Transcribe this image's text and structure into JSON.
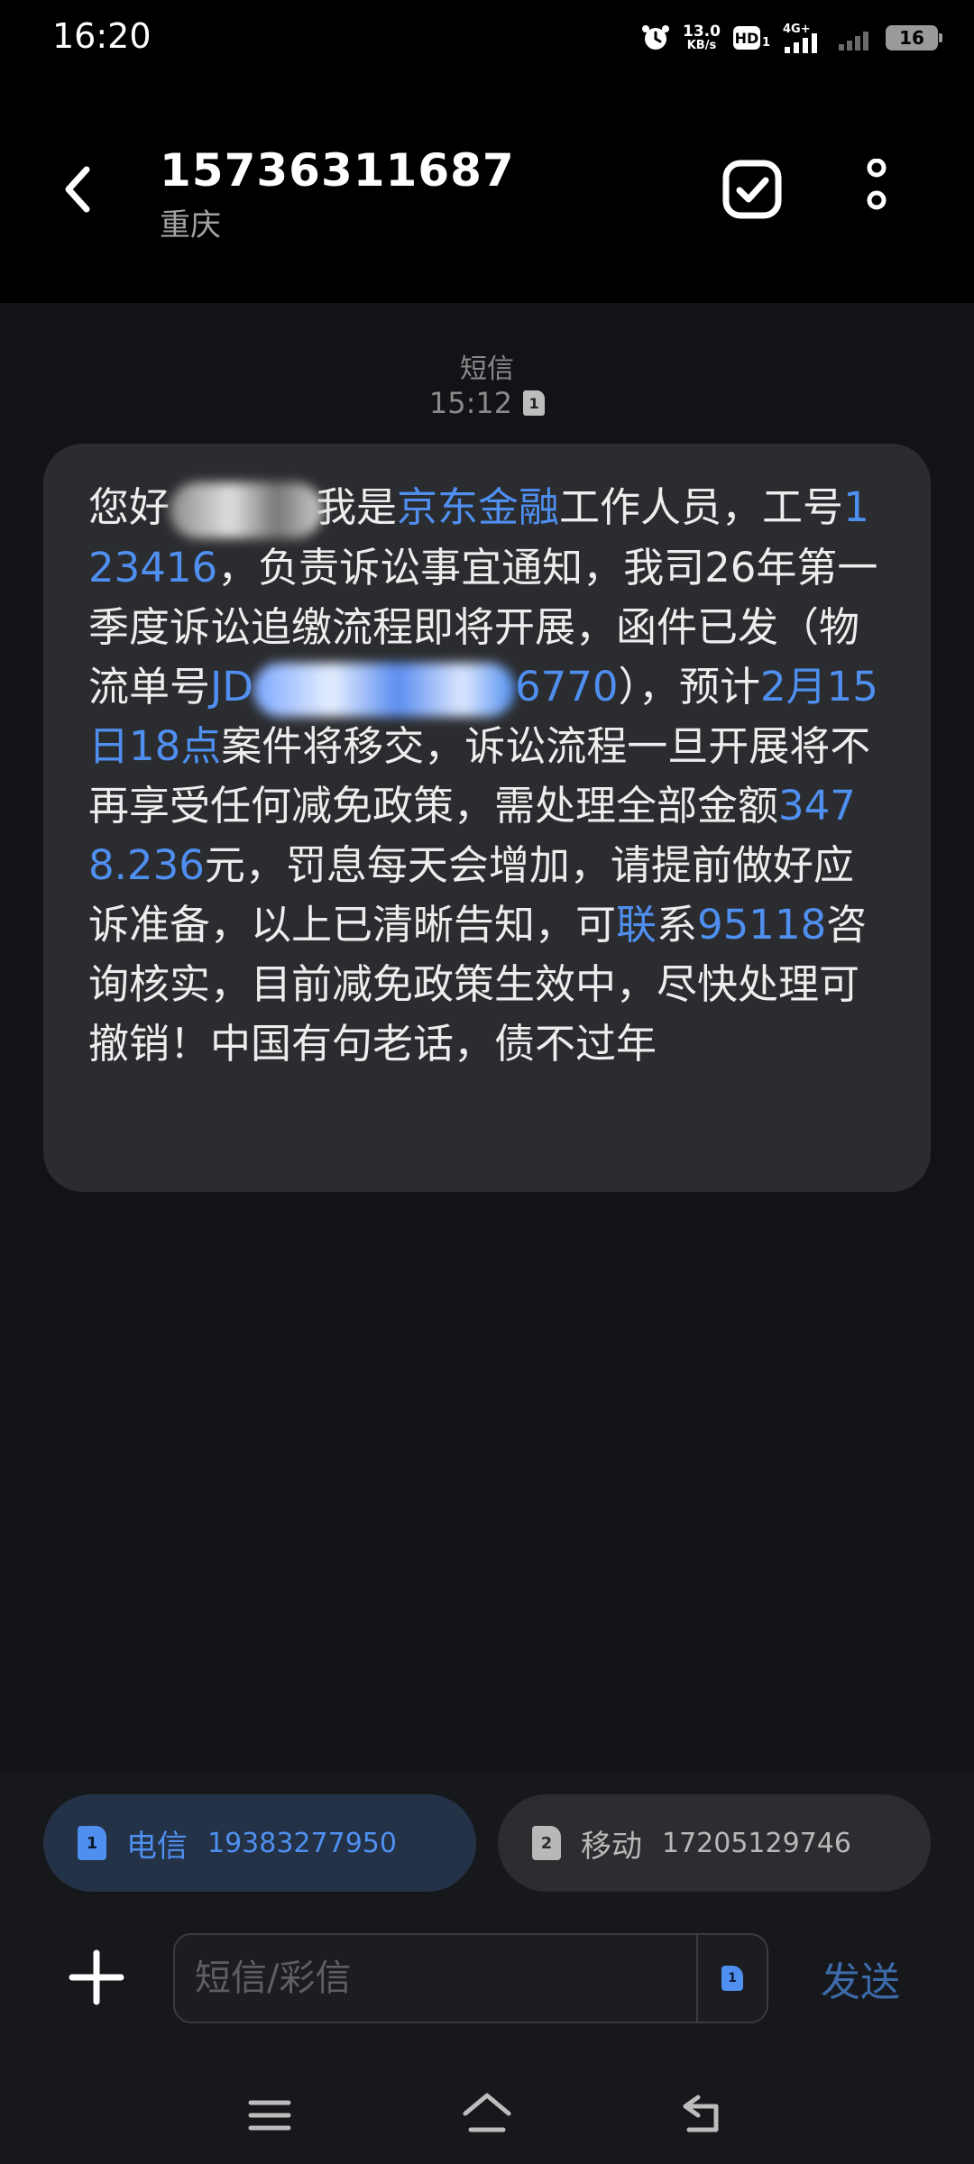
{
  "status_bar": {
    "time": "16:20",
    "net_speed_value": "13.0",
    "net_speed_unit": "KB/s",
    "hd_label": "HD",
    "hd_sub": "1",
    "network_type": "4G+",
    "battery": "16",
    "icons": [
      "alarm-icon",
      "hd-icon",
      "signal-icon",
      "signal-icon-2",
      "battery-icon"
    ]
  },
  "header": {
    "contact_number": "15736311687",
    "contact_location": "重庆",
    "icons": [
      "back-arrow-icon",
      "check-square-icon",
      "more-vertical-icon"
    ]
  },
  "thread": {
    "message_type": "短信",
    "timestamp": "15:12",
    "timestamp_sim": "1",
    "message": {
      "p1": "您好",
      "p2": "我是",
      "l1": "京东金融",
      "p3": "工作人员，工号",
      "l2": "123416",
      "p4": "，负责诉讼事宜通知，我司26年第一季度诉讼追缴流程即将开展，函件已发（物流单号",
      "l3a": "JD",
      "l3b": "6770",
      "p5": "），预计",
      "l4": "2月15日18点",
      "p6": "案件将移交，诉讼流程一旦开展将不再享受任何减免政策，需处理全部金额",
      "l5": "3478.236",
      "p7": "元，罚息每天会增加，请提前做好应诉准备，以上已清晰告知，可",
      "l6": "联",
      "p8": "系",
      "l7": "95118",
      "p9": "咨询核实，目前减免政策生效中，尽快处理可撤销！中国有句老话，债不过年"
    }
  },
  "sim_selector": {
    "sim1": {
      "index": "1",
      "carrier": "电信",
      "number": "19383277950"
    },
    "sim2": {
      "index": "2",
      "carrier": "移动",
      "number": "17205129746"
    }
  },
  "compose": {
    "placeholder": "短信/彩信",
    "sim_index": "1",
    "send_label": "发送"
  },
  "nav_bar": {
    "icons": [
      "menu-icon",
      "home-icon",
      "back-icon"
    ]
  },
  "colors": {
    "link": "#4f8ff0",
    "bubble": "#2b2c2f",
    "background": "#111317",
    "header": "#000000",
    "send_disabled": "#3d6aa8"
  }
}
